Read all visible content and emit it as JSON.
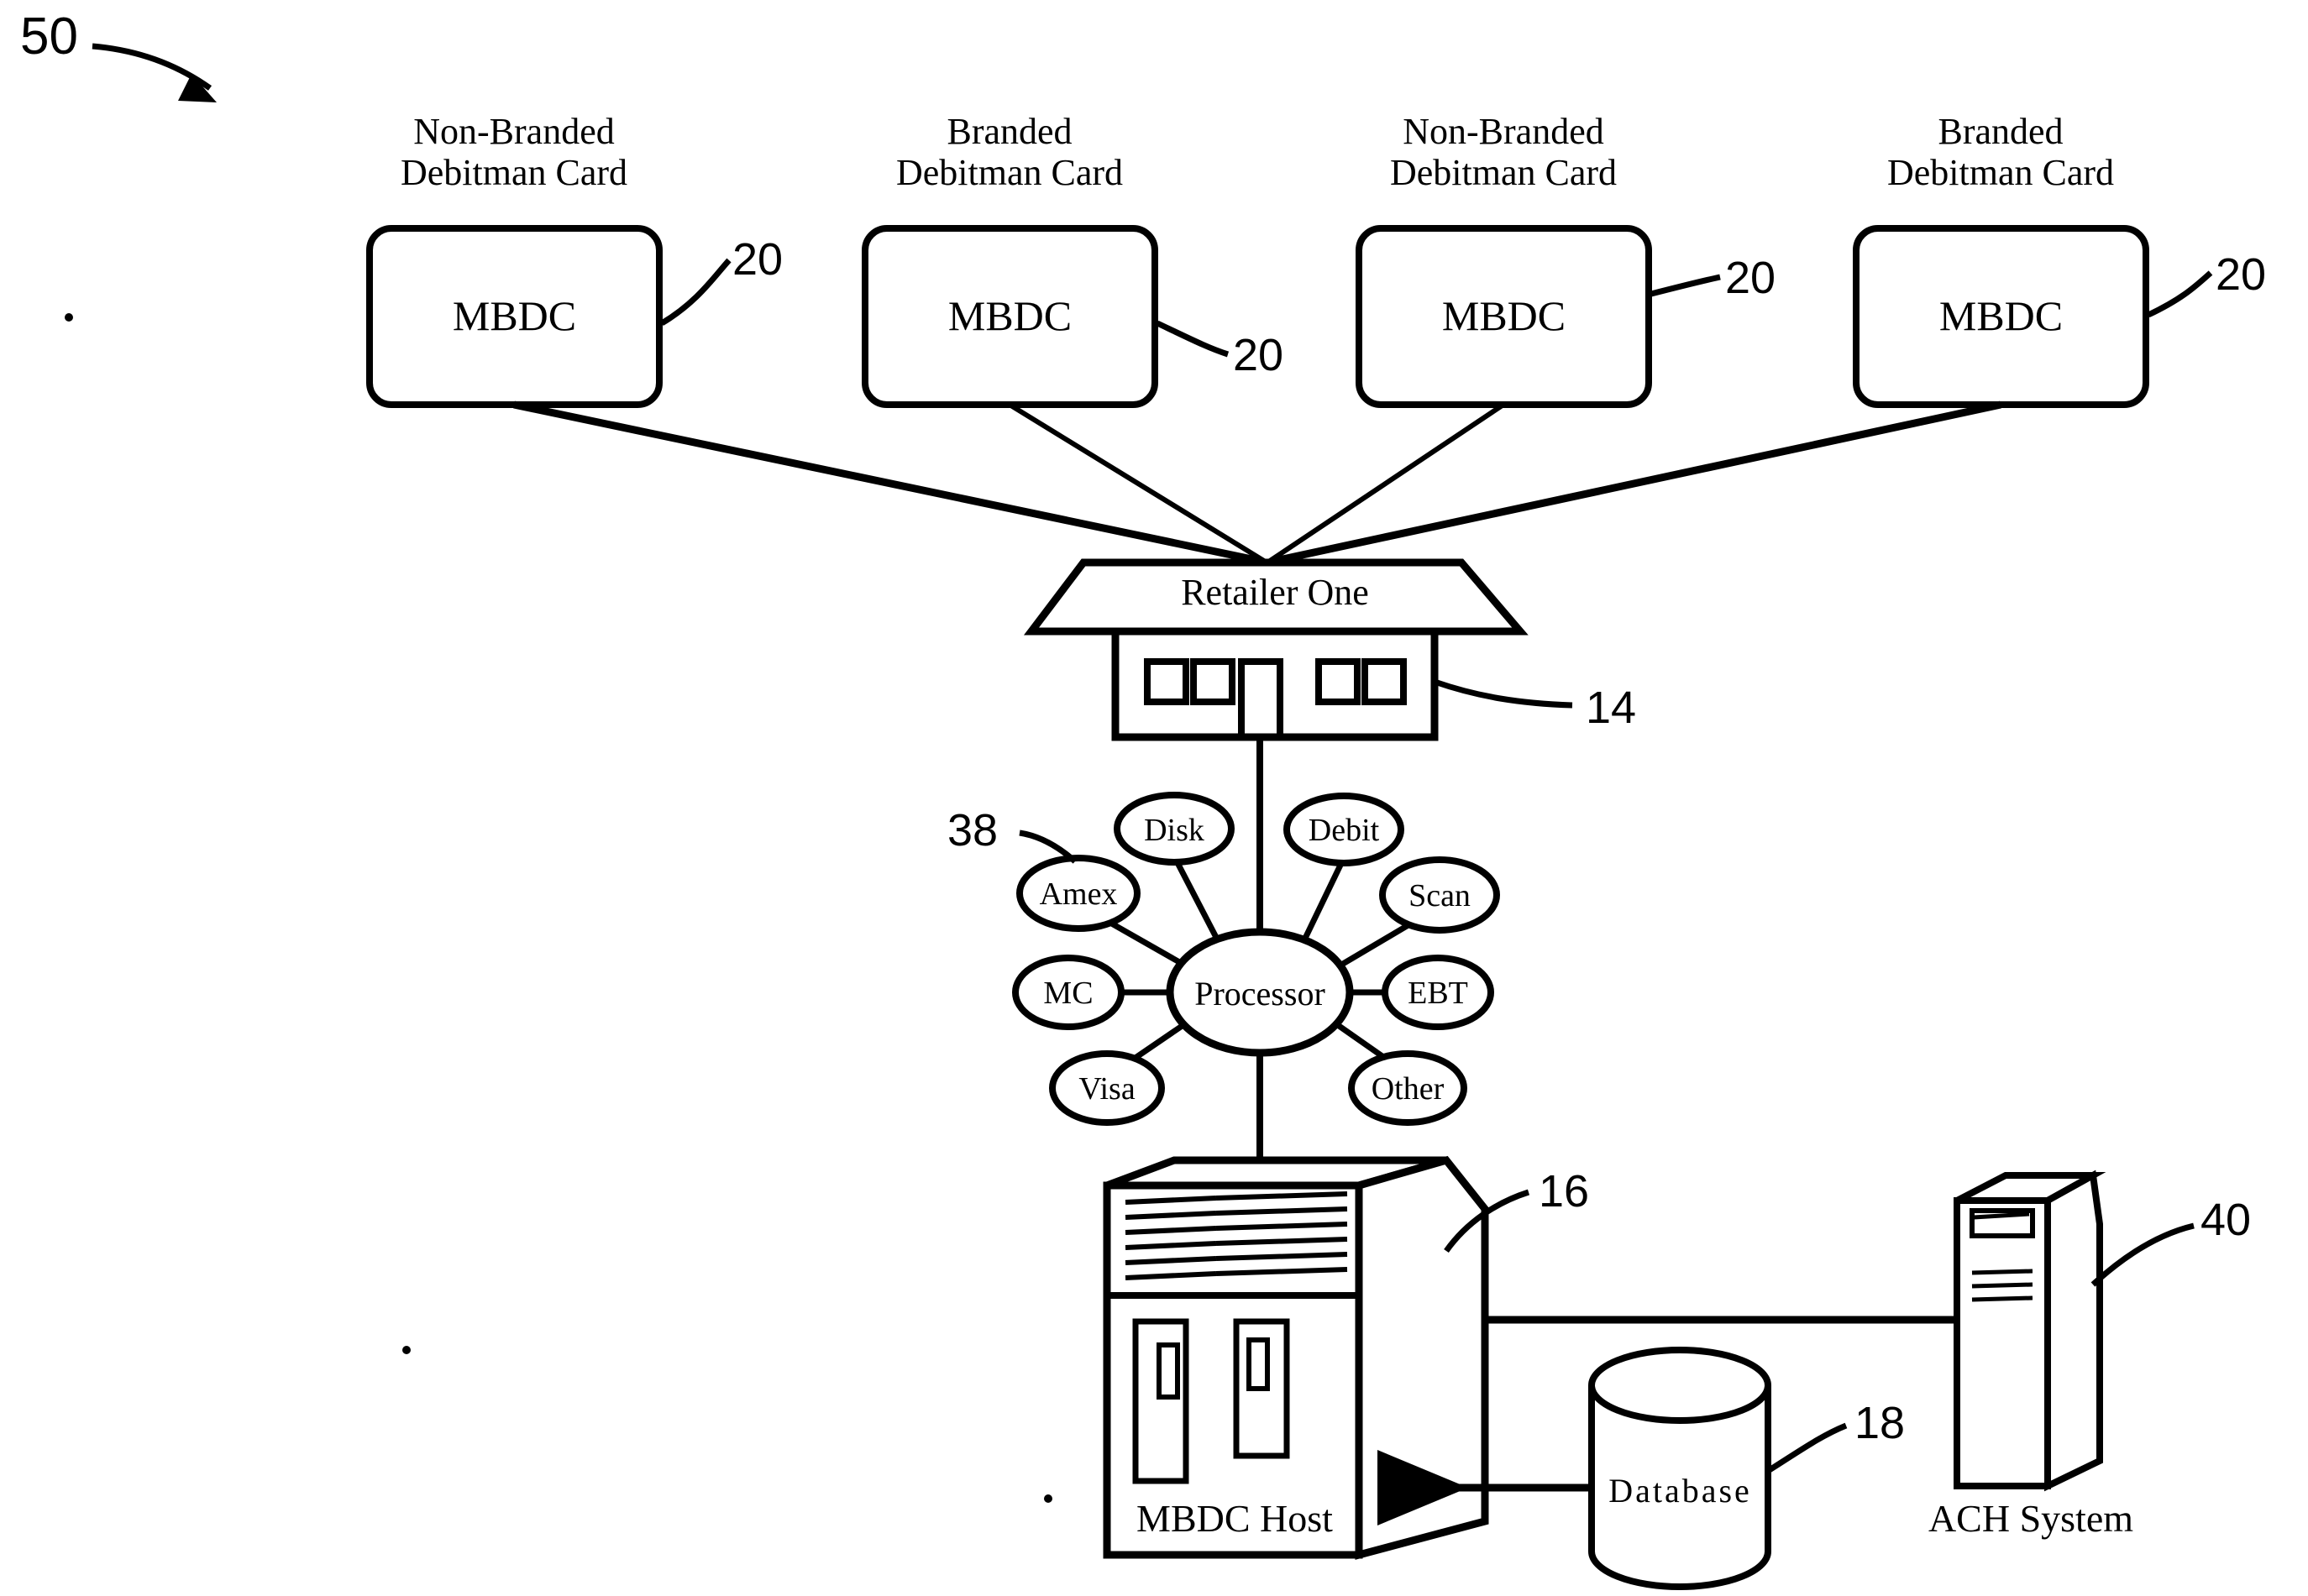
{
  "figure": {
    "reference_numeral": "50",
    "kind": "patent-figure"
  },
  "cards": [
    {
      "title_line1": "Non-Branded",
      "title_line2": "Debitman Card",
      "box_label": "MBDC",
      "ref": "20"
    },
    {
      "title_line1": "Branded",
      "title_line2": "Debitman Card",
      "box_label": "MBDC",
      "ref": "20"
    },
    {
      "title_line1": "Non-Branded",
      "title_line2": "Debitman Card",
      "box_label": "MBDC",
      "ref": "20"
    },
    {
      "title_line1": "Branded",
      "title_line2": "Debitman Card",
      "box_label": "MBDC",
      "ref": "20"
    }
  ],
  "retailer": {
    "label": "Retailer One",
    "ref": "14"
  },
  "processor": {
    "label": "Processor",
    "ref": "38",
    "spokes": [
      {
        "label": "Disk"
      },
      {
        "label": "Debit"
      },
      {
        "label": "Amex"
      },
      {
        "label": "Scan"
      },
      {
        "label": "MC"
      },
      {
        "label": "EBT"
      },
      {
        "label": "Visa"
      },
      {
        "label": "Other"
      }
    ]
  },
  "host": {
    "label": "MBDC Host",
    "ref": "16"
  },
  "database": {
    "label": "Database",
    "ref": "18"
  },
  "ach": {
    "label": "ACH System",
    "ref": "40"
  },
  "colors": {
    "ink": "#000000",
    "paper": "#ffffff"
  }
}
